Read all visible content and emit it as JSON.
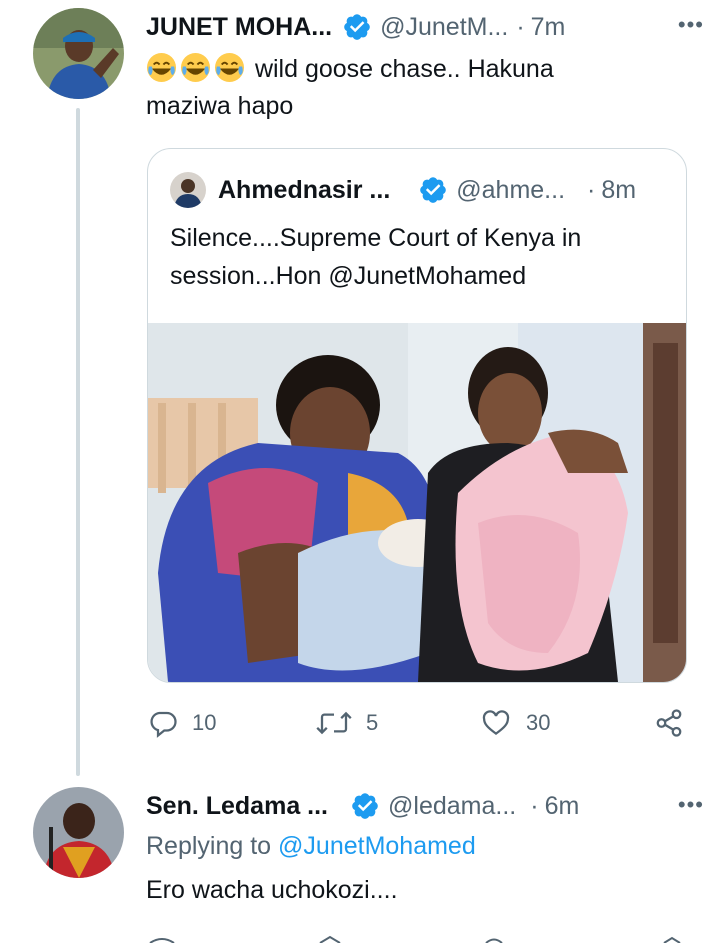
{
  "tweet1": {
    "name": "JUNET MOHA...",
    "handle": "@JunetM...",
    "dot": "·",
    "time": "7m",
    "more": "•••",
    "emoji_name": "joy-emoji",
    "text_line1": "wild goose chase.. Hakuna",
    "text_line2": "maziwa hapo",
    "quote": {
      "name": "Ahmednasir ...",
      "handle": "@ahme...",
      "dot": "·",
      "time": "8m",
      "text_line1": "Silence....Supreme Court of Kenya in",
      "text_line2": "session...Hon @JunetMohamed"
    },
    "actions": {
      "reply_count": "10",
      "retweet_count": "5",
      "like_count": "30"
    }
  },
  "tweet2": {
    "name": "Sen. Ledama ...",
    "handle": "@ledama...",
    "dot": "·",
    "time": "6m",
    "more": "•••",
    "replying_prefix": "Replying to",
    "replying_handle": "@JunetMohamed",
    "text": "Ero wacha uchokozi...."
  },
  "colors": {
    "verified": "#1d9bf0",
    "secondary_text": "#536471",
    "link": "#1d9bf0",
    "border": "#cfd9de"
  }
}
